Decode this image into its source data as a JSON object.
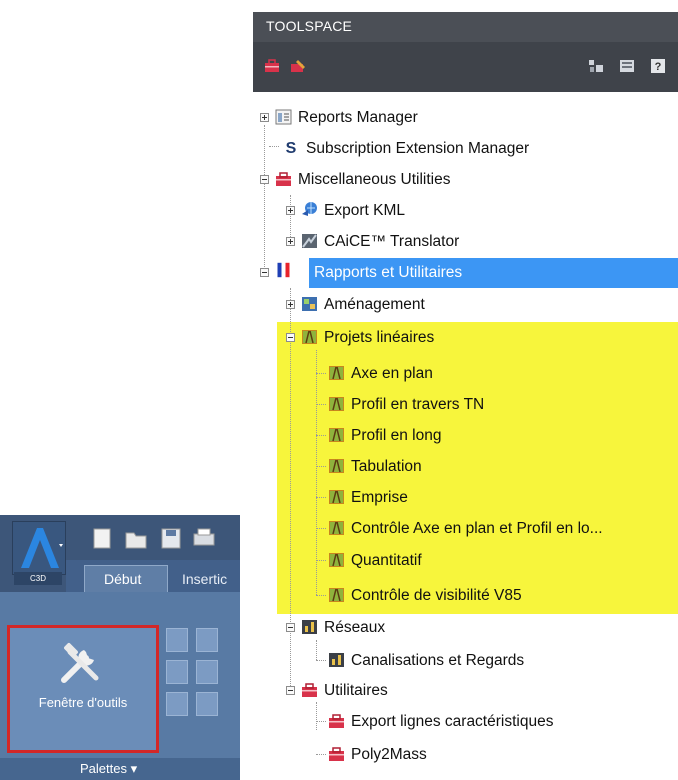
{
  "toolspace": {
    "title": "TOOLSPACE",
    "toolbar_icons": [
      "toolbox-icon",
      "edit-toolbox-icon",
      "layout-icon",
      "panel-icon",
      "help-icon"
    ],
    "tree": [
      {
        "label": "Reports Manager",
        "icon": "report-icon",
        "expander": "plus"
      },
      {
        "label": "Subscription Extension Manager",
        "icon": "subscription-s-icon",
        "expander": "none"
      },
      {
        "label": "Miscellaneous Utilities",
        "icon": "toolbox-icon",
        "expander": "minus"
      },
      {
        "label": "Export KML",
        "icon": "globe-export-icon",
        "expander": "plus"
      },
      {
        "label": "CAiCE™ Translator",
        "icon": "translator-icon",
        "expander": "plus"
      },
      {
        "label": "Rapports et Utilitaires",
        "icon": "french-flag-icon",
        "expander": "minus",
        "selected": true
      },
      {
        "label": "Aménagement",
        "icon": "map-icon",
        "expander": "plus"
      },
      {
        "label": "Projets linéaires",
        "icon": "road-icon",
        "expander": "minus"
      },
      {
        "label": "Axe en plan",
        "icon": "road-icon"
      },
      {
        "label": "Profil en travers TN",
        "icon": "road-icon"
      },
      {
        "label": "Profil en long",
        "icon": "road-icon"
      },
      {
        "label": "Tabulation",
        "icon": "road-icon"
      },
      {
        "label": "Emprise",
        "icon": "road-icon"
      },
      {
        "label": "Contrôle Axe en plan et Profil en lo...",
        "icon": "road-icon"
      },
      {
        "label": "Quantitatif",
        "icon": "road-icon"
      },
      {
        "label": "Contrôle de visibilité V85",
        "icon": "road-icon"
      },
      {
        "label": "Réseaux",
        "icon": "pipe-network-icon",
        "expander": "minus"
      },
      {
        "label": "Canalisations et Regards",
        "icon": "pipe-network-icon"
      },
      {
        "label": "Utilitaires",
        "icon": "toolbox-icon",
        "expander": "minus"
      },
      {
        "label": "Export lignes caractéristiques",
        "icon": "toolbox-icon"
      },
      {
        "label": "Poly2Mass",
        "icon": "toolbox-icon"
      }
    ]
  },
  "ribbon": {
    "app_label": "C3D",
    "tab_active": "Début",
    "tab_next": "Insertic",
    "big_button_label": "Fenêtre d'outils",
    "panel_label": "Palettes ▾"
  },
  "colors": {
    "selection": "#3c96f4",
    "highlight": "#f7f53c",
    "title_bar": "#4b4f56",
    "ribbon_border": "#d32727"
  }
}
